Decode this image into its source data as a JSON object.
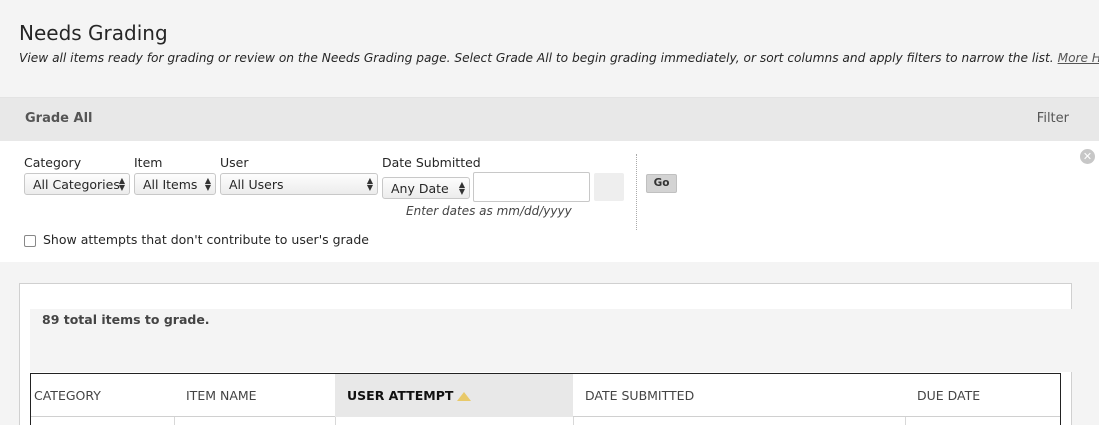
{
  "header": {
    "title": "Needs Grading",
    "description": "View all items ready for grading or review on the Needs Grading page. Select Grade All to begin grading immediately, or sort columns and apply filters to narrow the list.",
    "help_link": "More Help"
  },
  "action_bar": {
    "grade_all": "Grade All",
    "filter": "Filter"
  },
  "filters": {
    "category": {
      "label": "Category",
      "value": "All Categories"
    },
    "item": {
      "label": "Item",
      "value": "All Items"
    },
    "user": {
      "label": "User",
      "value": "All Users"
    },
    "date_submitted": {
      "label": "Date Submitted",
      "value": "Any Date",
      "input_value": "",
      "hint": "Enter dates as mm/dd/yyyy"
    },
    "go": "Go",
    "close_icon": "close-circle-icon",
    "checkbox": {
      "label": "Show attempts that don't contribute to user's grade",
      "checked": false
    }
  },
  "grading": {
    "count_text": "89 total items to grade.",
    "columns": [
      "CATEGORY",
      "ITEM NAME",
      "USER ATTEMPT",
      "DATE SUBMITTED",
      "DUE DATE"
    ],
    "sorted_column": "USER ATTEMPT",
    "sort_icon": "sort-ascending-icon"
  }
}
